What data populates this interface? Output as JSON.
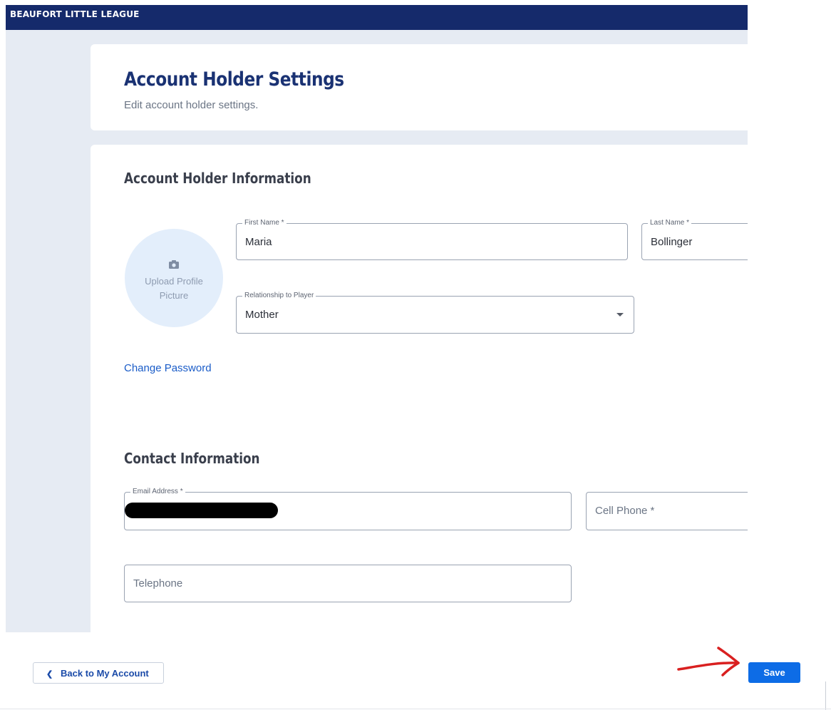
{
  "header": {
    "brand": "BEAUFORT LITTLE LEAGUE"
  },
  "page": {
    "title": "Account Holder Settings",
    "subtitle": "Edit account holder settings."
  },
  "account_section": {
    "title": "Account Holder Information",
    "avatar": {
      "upload_label": "Upload Profile Picture"
    },
    "first_name": {
      "label": "First Name *",
      "value": "Maria"
    },
    "last_name": {
      "label": "Last Name *",
      "value": "Bollinger"
    },
    "relationship": {
      "label": "Relationship to Player",
      "value": "Mother"
    },
    "change_password": "Change Password"
  },
  "contact_section": {
    "title": "Contact Information",
    "email": {
      "label": "Email Address *"
    },
    "cell_phone": {
      "placeholder": "Cell Phone *"
    },
    "telephone": {
      "placeholder": "Telephone"
    }
  },
  "footer": {
    "back_label": "Back to My Account",
    "save_label": "Save"
  },
  "colors": {
    "navbar": "#152a6b",
    "title": "#1a3273",
    "link": "#1a5cc8",
    "primary": "#0d6ce6",
    "annotation": "#d92020"
  }
}
